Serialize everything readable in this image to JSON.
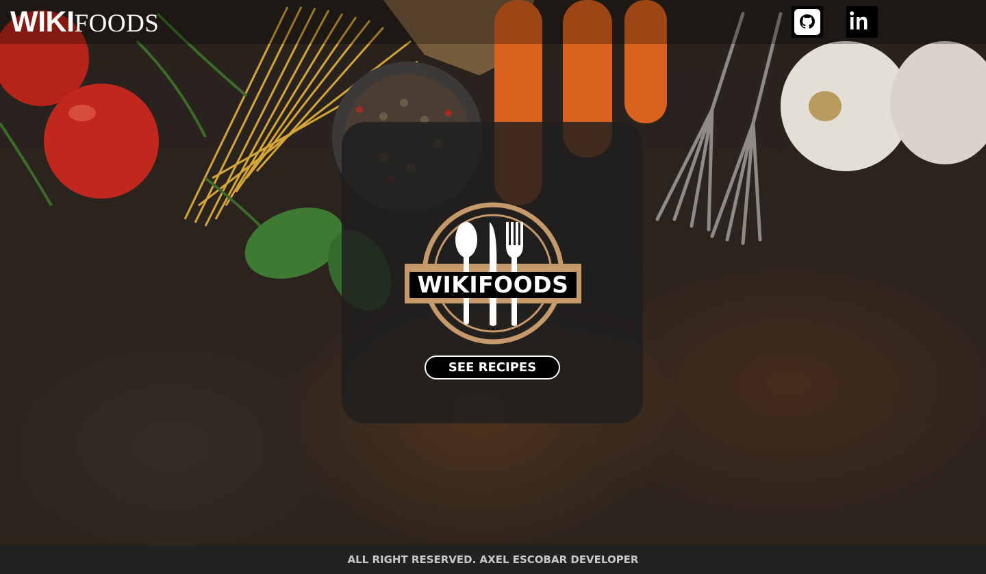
{
  "header": {
    "brand_bold": "WIKI",
    "brand_regular": "FOODS",
    "social": [
      {
        "name": "github-icon"
      },
      {
        "name": "linkedin-icon"
      }
    ]
  },
  "hero": {
    "logo_text": "WIKIFOODS",
    "button_label": "SEE RECIPES"
  },
  "footer": {
    "text": "ALL RIGHT RESERVED. AXEL ESCOBAR DEVELOPER"
  },
  "colors": {
    "accent_ring": "#c6996a",
    "card_bg": "#1e1e1e",
    "footer_bg": "#222222"
  }
}
